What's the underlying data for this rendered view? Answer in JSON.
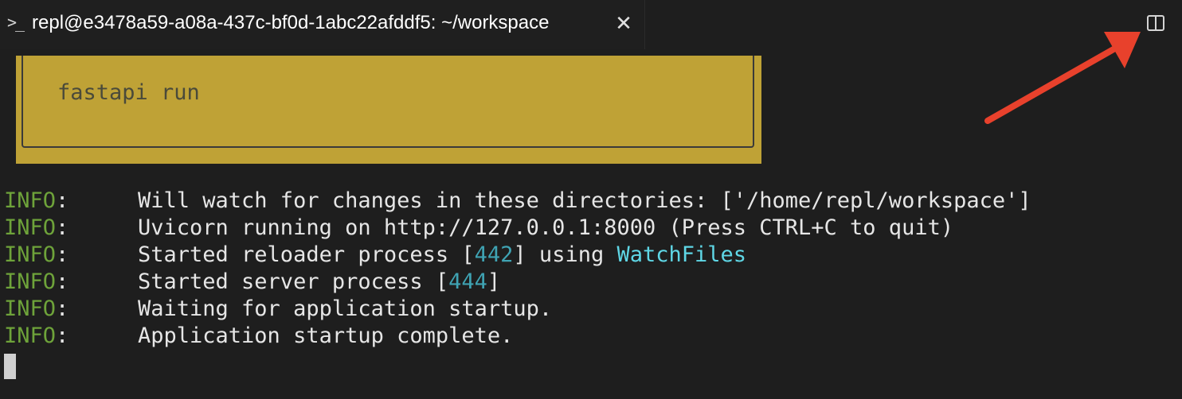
{
  "tab": {
    "icon": "terminal-icon",
    "prompt_glyph": ">_",
    "title": "repl@e3478a59-a08a-437c-bf0d-1abc22afddf5: ~/workspace",
    "close_glyph": "✕"
  },
  "toolbar": {
    "split_icon": "split-editor-icon"
  },
  "banner": {
    "command": "fastapi run"
  },
  "log": [
    {
      "level": "INFO",
      "sep": ":",
      "parts": [
        {
          "text": "Will watch for changes in these directories: ['/home/repl/workspace']",
          "style": "plain"
        }
      ]
    },
    {
      "level": "INFO",
      "sep": ":",
      "parts": [
        {
          "text": "Uvicorn running on http://127.0.0.1:8000 (Press CTRL+C to quit)",
          "style": "plain"
        }
      ]
    },
    {
      "level": "INFO",
      "sep": ":",
      "parts": [
        {
          "text": "Started reloader process [",
          "style": "plain"
        },
        {
          "text": "442",
          "style": "num"
        },
        {
          "text": "] using ",
          "style": "plain"
        },
        {
          "text": "WatchFiles",
          "style": "wf"
        }
      ]
    },
    {
      "level": "INFO",
      "sep": ":",
      "parts": [
        {
          "text": "Started server process [",
          "style": "plain"
        },
        {
          "text": "444",
          "style": "num"
        },
        {
          "text": "]",
          "style": "plain"
        }
      ]
    },
    {
      "level": "INFO",
      "sep": ":",
      "parts": [
        {
          "text": "Waiting for application startup.",
          "style": "plain"
        }
      ]
    },
    {
      "level": "INFO",
      "sep": ":",
      "parts": [
        {
          "text": "Application startup complete.",
          "style": "plain"
        }
      ]
    }
  ],
  "colors": {
    "background": "#1e1e1e",
    "banner": "#bfa236",
    "info_level": "#6ea33a",
    "number": "#3fa3b3",
    "watchfiles": "#5fd7e6",
    "annotation_arrow": "#e8412c"
  }
}
